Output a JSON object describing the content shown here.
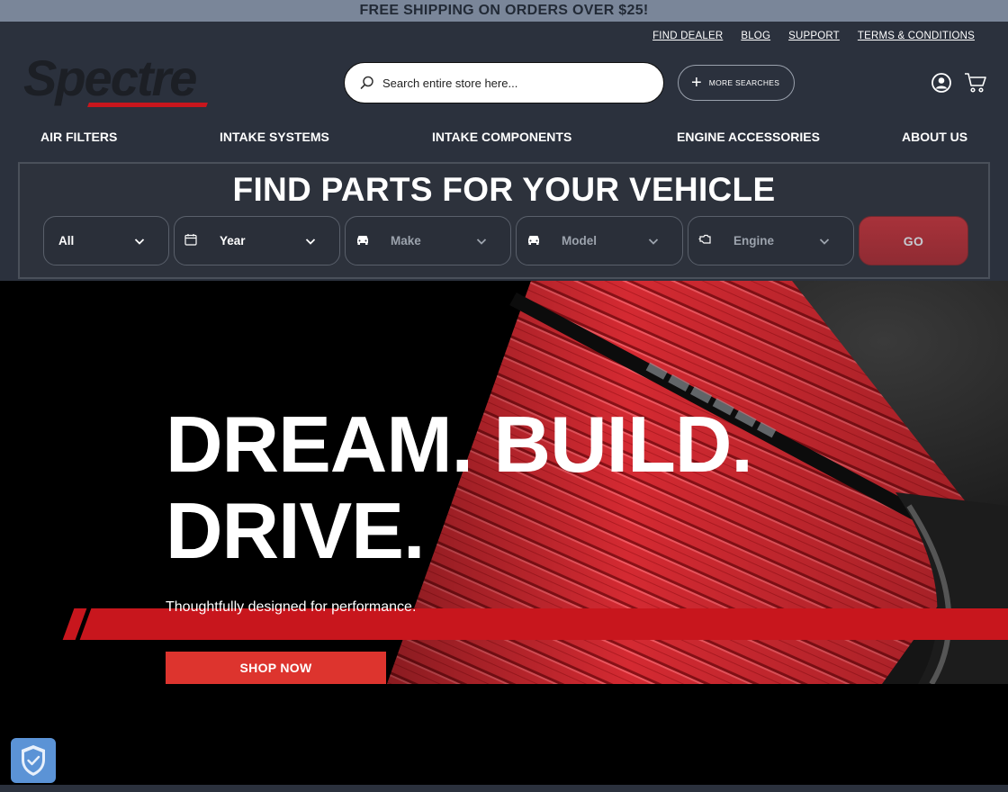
{
  "promo": {
    "text": "FREE SHIPPING ON ORDERS OVER $25!"
  },
  "utility_links": [
    "FIND DEALER",
    "BLOG",
    "SUPPORT",
    "TERMS & CONDITIONS"
  ],
  "logo": {
    "text": "Spectre"
  },
  "search": {
    "placeholder": "Search entire store here..."
  },
  "more_searches": {
    "label": "MORE SEARCHES"
  },
  "nav": {
    "air_filters": "AIR FILTERS",
    "intake_systems": "INTAKE SYSTEMS",
    "intake_components": "INTAKE COMPONENTS",
    "engine_accessories": "ENGINE ACCESSORIES",
    "about_us": "ABOUT US"
  },
  "finder": {
    "title": "FIND PARTS FOR YOUR VEHICLE",
    "selects": {
      "all": "All",
      "year": "Year",
      "make": "Make",
      "model": "Model",
      "engine": "Engine"
    },
    "go_label": "GO"
  },
  "hero": {
    "headline_line1": "DREAM. BUILD.",
    "headline_line2": "DRIVE.",
    "subhead": "Thoughtfully designed for performance.",
    "cta": "SHOP NOW"
  },
  "colors": {
    "brand_red": "#c8161d",
    "header_bg": "#2b313d",
    "promo_bg": "#7a8699",
    "cta_red": "#dd342e"
  }
}
